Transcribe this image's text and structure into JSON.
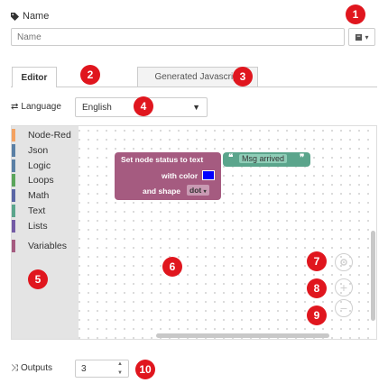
{
  "name_field": {
    "label": "Name",
    "placeholder": "Name"
  },
  "tabs": [
    {
      "label": "Editor",
      "active": true
    },
    {
      "label": "Generated Javascript",
      "active": false
    }
  ],
  "language": {
    "label": "Language",
    "value": "English"
  },
  "toolbox": {
    "categories": [
      {
        "label": "Node-Red",
        "color": "#f4a261"
      },
      {
        "label": "Json",
        "color": "#5b80a5"
      },
      {
        "label": "Logic",
        "color": "#5b80a5"
      },
      {
        "label": "Loops",
        "color": "#5ba55b"
      },
      {
        "label": "Math",
        "color": "#5b67a5"
      },
      {
        "label": "Text",
        "color": "#5ba58c"
      },
      {
        "label": "Lists",
        "color": "#745ba5"
      },
      {
        "label": "Variables",
        "color": "#a55b80"
      }
    ]
  },
  "block": {
    "line1": "Set node status  to text",
    "line2": "with color",
    "line3": "and shape",
    "shape_value": "dot",
    "text_value": "Msg arrived",
    "color_value": "#0000ff"
  },
  "outputs": {
    "label": "Outputs",
    "value": "3"
  },
  "markers": [
    "1",
    "2",
    "3",
    "4",
    "5",
    "6",
    "7",
    "8",
    "9",
    "10"
  ]
}
